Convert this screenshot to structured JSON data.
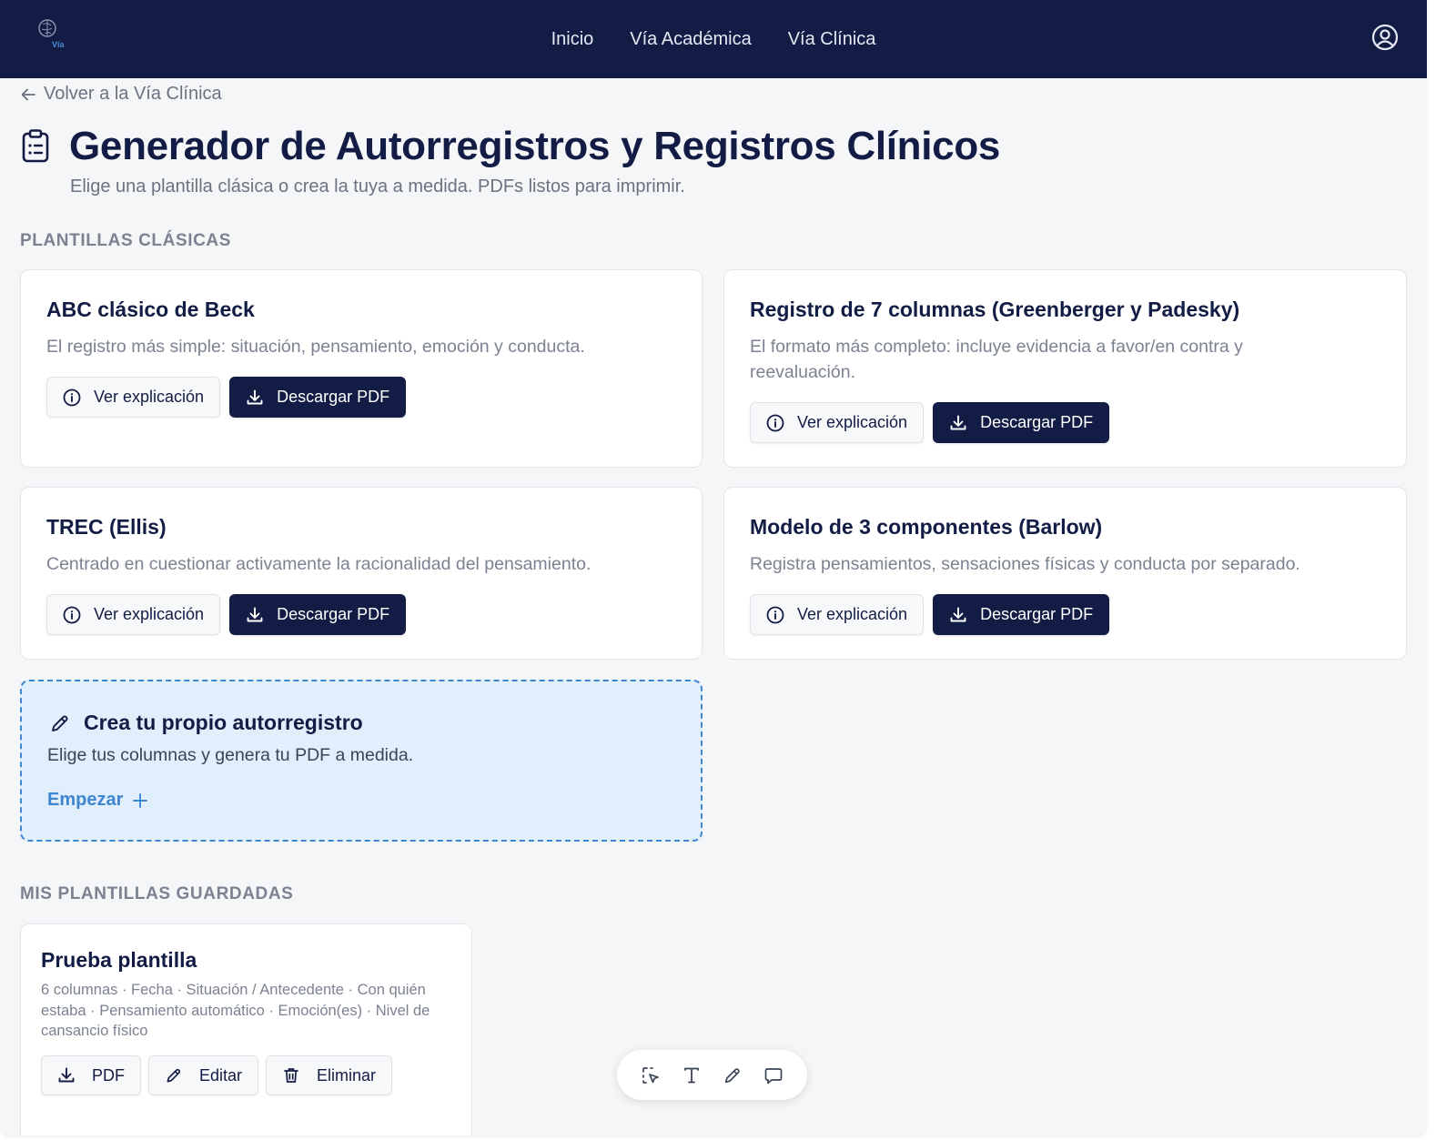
{
  "nav": {
    "logo_text": "Vía",
    "links": [
      "Inicio",
      "Vía Académica",
      "Vía Clínica"
    ]
  },
  "back_link": "Volver a la Vía Clínica",
  "page": {
    "title": "Generador de Autorregistros y Registros Clínicos",
    "subtitle": "Elige una plantilla clásica o crea la tuya a medida. PDFs listos para imprimir."
  },
  "sections": {
    "classic": "PLANTILLAS CLÁSICAS",
    "saved": "MIS PLANTILLAS GUARDADAS"
  },
  "templates": [
    {
      "title": "ABC clásico de Beck",
      "description": "El registro más simple: situación, pensamiento, emoción y conducta."
    },
    {
      "title": "Registro de 7 columnas (Greenberger y Padesky)",
      "description": "El formato más completo: incluye evidencia a favor/en contra y reevaluación."
    },
    {
      "title": "TREC (Ellis)",
      "description": "Centrado en cuestionar activamente la racionalidad del pensamiento."
    },
    {
      "title": "Modelo de 3 componentes (Barlow)",
      "description": "Registra pensamientos, sensaciones físicas y conducta por separado."
    }
  ],
  "buttons": {
    "explain": "Ver explicación",
    "download": "Descargar PDF"
  },
  "create": {
    "title": "Crea tu propio autorregistro",
    "description": "Elige tus columnas y genera tu PDF a medida.",
    "cta": "Empezar"
  },
  "saved": [
    {
      "title": "Prueba plantilla",
      "description": "6 columnas · Fecha · Situación / Antecedente · Con quién estaba · Pensamiento automático · Emoción(es) · Nivel de cansancio físico",
      "actions": [
        "PDF",
        "Editar",
        "Eliminar"
      ]
    }
  ],
  "toolbar_tools": [
    "select-tool-icon",
    "text-tool-icon",
    "pencil-tool-icon",
    "comment-tool-icon"
  ],
  "colors": {
    "navy": "#121c44",
    "accent_blue": "#3f86cf",
    "create_bg": "#e1eefb",
    "page_bg": "#f5f6f8"
  }
}
